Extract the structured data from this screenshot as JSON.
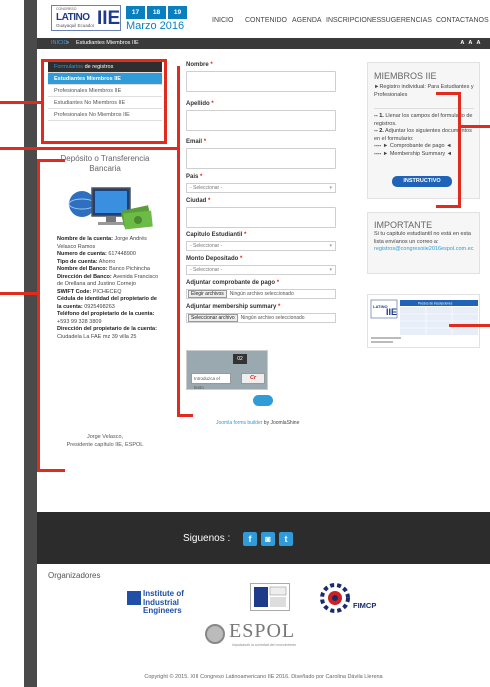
{
  "header": {
    "logo": {
      "line1": "CONGRESO",
      "word": "LATINO",
      "line3": "AMERICANO",
      "iie": "IIE",
      "sub": "Guayaquil Ecuador"
    },
    "days": [
      "17",
      "18",
      "19"
    ],
    "date": "Marzo 2016",
    "nav": [
      "INICIO",
      "CONTENIDO",
      "AGENDA",
      "INSCRIPCIONES",
      "SUGERENCIAS",
      "CONTACTANOS"
    ]
  },
  "breadcrumb": {
    "home": "INICIO",
    "sep": "»",
    "current": "Estudiantes Miembros IIE",
    "font_size": "A A A"
  },
  "side_menu": {
    "header_hl": "Formularios",
    "header_rest": "de registros",
    "items": [
      "Estudiantes Miembros IIE",
      "Profesionales Miembros IIE",
      "Estudiantes No Miembros IIE",
      "Profesionales No Miembros IIE"
    ]
  },
  "deposit": {
    "title": "Depósito o Transferencia Bancaria",
    "rows": [
      {
        "label": "Nombre de la cuenta:",
        "value": "Jorge Andrés Velasco Ramos"
      },
      {
        "label": "Numero de cuenta:",
        "value": "617448900"
      },
      {
        "label": "Tipo de cuenta:",
        "value": "Ahorro"
      },
      {
        "label": "Nombre del Banco:",
        "value": "Banco Pichincha"
      },
      {
        "label": "Dirección del Banco:",
        "value": "Avenida Francisco de Orellana and Justino Cornejo"
      },
      {
        "label": "SWIFT Code:",
        "value": "PICHECEQ"
      },
      {
        "label": "Cédula de identidad del propietario de la cuenta:",
        "value": "0925498263"
      },
      {
        "label": "Teléfono del propietario de la cuenta:",
        "value": "+593 99 328 3809"
      },
      {
        "label": "Dirección del propietario de la cuenta:",
        "value": "Ciudadela La FAE mz 39 villa 25"
      }
    ],
    "signer_name": "Jorge Velasco,",
    "signer_role": "Presidente capítulo IIE, ESPOL"
  },
  "form": {
    "nombre": "Nombre",
    "apellido": "Apellido",
    "email": "Email",
    "pais": "Pais",
    "pais_placeholder": "- Seleccionar -",
    "ciudad": "Ciudad",
    "capitulo": "Capitulo Estudiantil",
    "capitulo_placeholder": "- Seleccionar -",
    "monto": "Monto Depositado",
    "monto_placeholder": "- Seleccionar -",
    "comprobante": "Adjuntar comprobante de pago",
    "membership": "Adjuntar membership summary",
    "file_btn1": "Elegir archivos",
    "file_txt1": "Ningún archivo seleccionado",
    "file_btn2": "Seleccionar archivo",
    "file_txt2": "Ningún archivo seleccionado",
    "required_mark": "*",
    "captcha_placeholder": "Introduzca el texto",
    "captcha_code": "Cr",
    "captcha_digits": "02",
    "footer_link": "Joomla forms builder",
    "footer_rest": "by JoomlaShine"
  },
  "miembros": {
    "title": "MIEMBROS IIE",
    "subtitle": "►Registro individual: Para Estudiantes y Profesionales",
    "steps": [
      {
        "n": "-- 1.",
        "t": "Llenar los campos del formulario de registros."
      },
      {
        "n": "-- 2.",
        "t": "Adjuntar los siguientes documentos en el formulario:"
      },
      {
        "n": "----",
        "t": "► Comprobante de pago ◄"
      },
      {
        "n": "----",
        "t": "► Membership Summary ◄"
      }
    ],
    "button": "INSTRUCTIVO"
  },
  "importante": {
    "title": "IMPORTANTE",
    "text": "Si tu capitulo estudiantil no está en esta lista envíanos un correo a:",
    "email": "registros@congresoiie2016espol.com.ec"
  },
  "ticket": {
    "title": "Precios de inscripciones"
  },
  "footer": {
    "follow": "Siguenos :",
    "social": [
      "f",
      "◙",
      "t"
    ],
    "orgs": "Organizadores",
    "iie_line1": "Institute of",
    "iie_line2": "Industrial Engineers",
    "fimcp": "FIMCP",
    "espol": "ESPOL",
    "espol_tag": "Impulsando la sociedad del conocimiento",
    "copyright": "Copyright © 2015. XIII Congreso Latinoamericano IIE 2016. Diseñado por Carolina Dávila Llerena"
  },
  "colors": {
    "accent": "#2f9bd8",
    "annotation": "#e02b1e",
    "dark": "#2c2c2c"
  }
}
